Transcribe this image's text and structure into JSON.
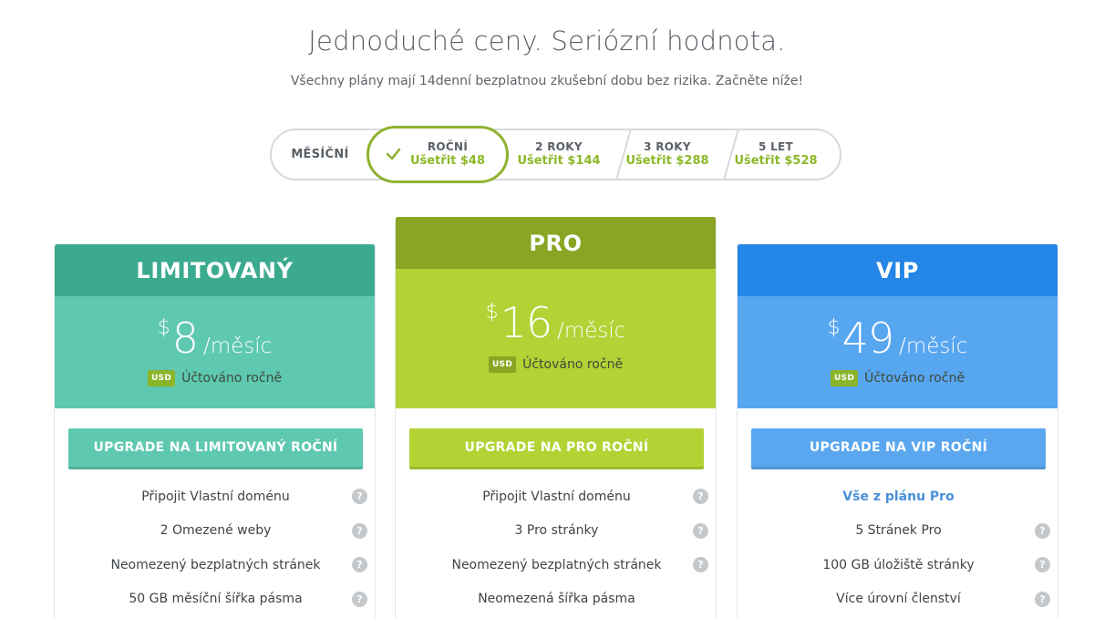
{
  "header": {
    "title": "Jednoduché ceny. Seriózní hodnota.",
    "subtitle": "Všechny plány mají 14denní bezplatnou zkušební dobu bez rizika. Začněte níže!"
  },
  "billing_toggle": {
    "selected": "ROČNÍ",
    "options": [
      {
        "label": "MĚSÍČNÍ",
        "save": ""
      },
      {
        "label": "ROČNÍ",
        "save": "Ušetřit $48"
      },
      {
        "label": "2 ROKY",
        "save": "Ušetřit $144"
      },
      {
        "label": "3 ROKY",
        "save": "Ušetřit $288"
      },
      {
        "label": "5 LET",
        "save": "Ušetřit $528"
      }
    ]
  },
  "plans": {
    "limited": {
      "name": "LIMITOVANÝ",
      "currency_symbol": "$",
      "amount": "8",
      "period": "/měsíc",
      "currency": "USD",
      "billed": "Účtováno ročně",
      "cta": "UPGRADE NA LIMITOVANÝ ROČNÍ",
      "features": [
        {
          "text": "Připojit Vlastní doménu"
        },
        {
          "text": "2 Omezené weby"
        },
        {
          "text": "Neomezený bezplatných stránek"
        },
        {
          "text": "50 GB měsíční šířka pásma"
        }
      ],
      "colors": {
        "header": "#3caa8e",
        "price_bg": "#5ec8b0"
      }
    },
    "pro": {
      "name": "PRO",
      "currency_symbol": "$",
      "amount": "16",
      "period": "/měsíc",
      "currency": "USD",
      "billed": "Účtováno ročně",
      "cta": "UPGRADE NA PRO ROČNÍ",
      "features": [
        {
          "text": "Připojit Vlastní doménu"
        },
        {
          "text": "3 Pro stránky"
        },
        {
          "text": "Neomezený bezplatných stránek"
        },
        {
          "text": "Neomezená šířka pásma"
        }
      ],
      "colors": {
        "header": "#8aa523",
        "price_bg": "#b2d235"
      }
    },
    "vip": {
      "name": "VIP",
      "currency_symbol": "$",
      "amount": "49",
      "period": "/měsíc",
      "currency": "USD",
      "billed": "Účtováno ročně",
      "cta": "UPGRADE NA VIP ROČNÍ",
      "features": [
        {
          "text": "Vše z plánu Pro"
        },
        {
          "text": "5 Stránek Pro"
        },
        {
          "text": "100 GB úložiště stránky"
        },
        {
          "text": "Více úrovní členství"
        }
      ],
      "colors": {
        "header": "#2486e6",
        "price_bg": "#57a6f0"
      }
    }
  },
  "icons": {
    "help": "?",
    "check": "check-icon"
  }
}
